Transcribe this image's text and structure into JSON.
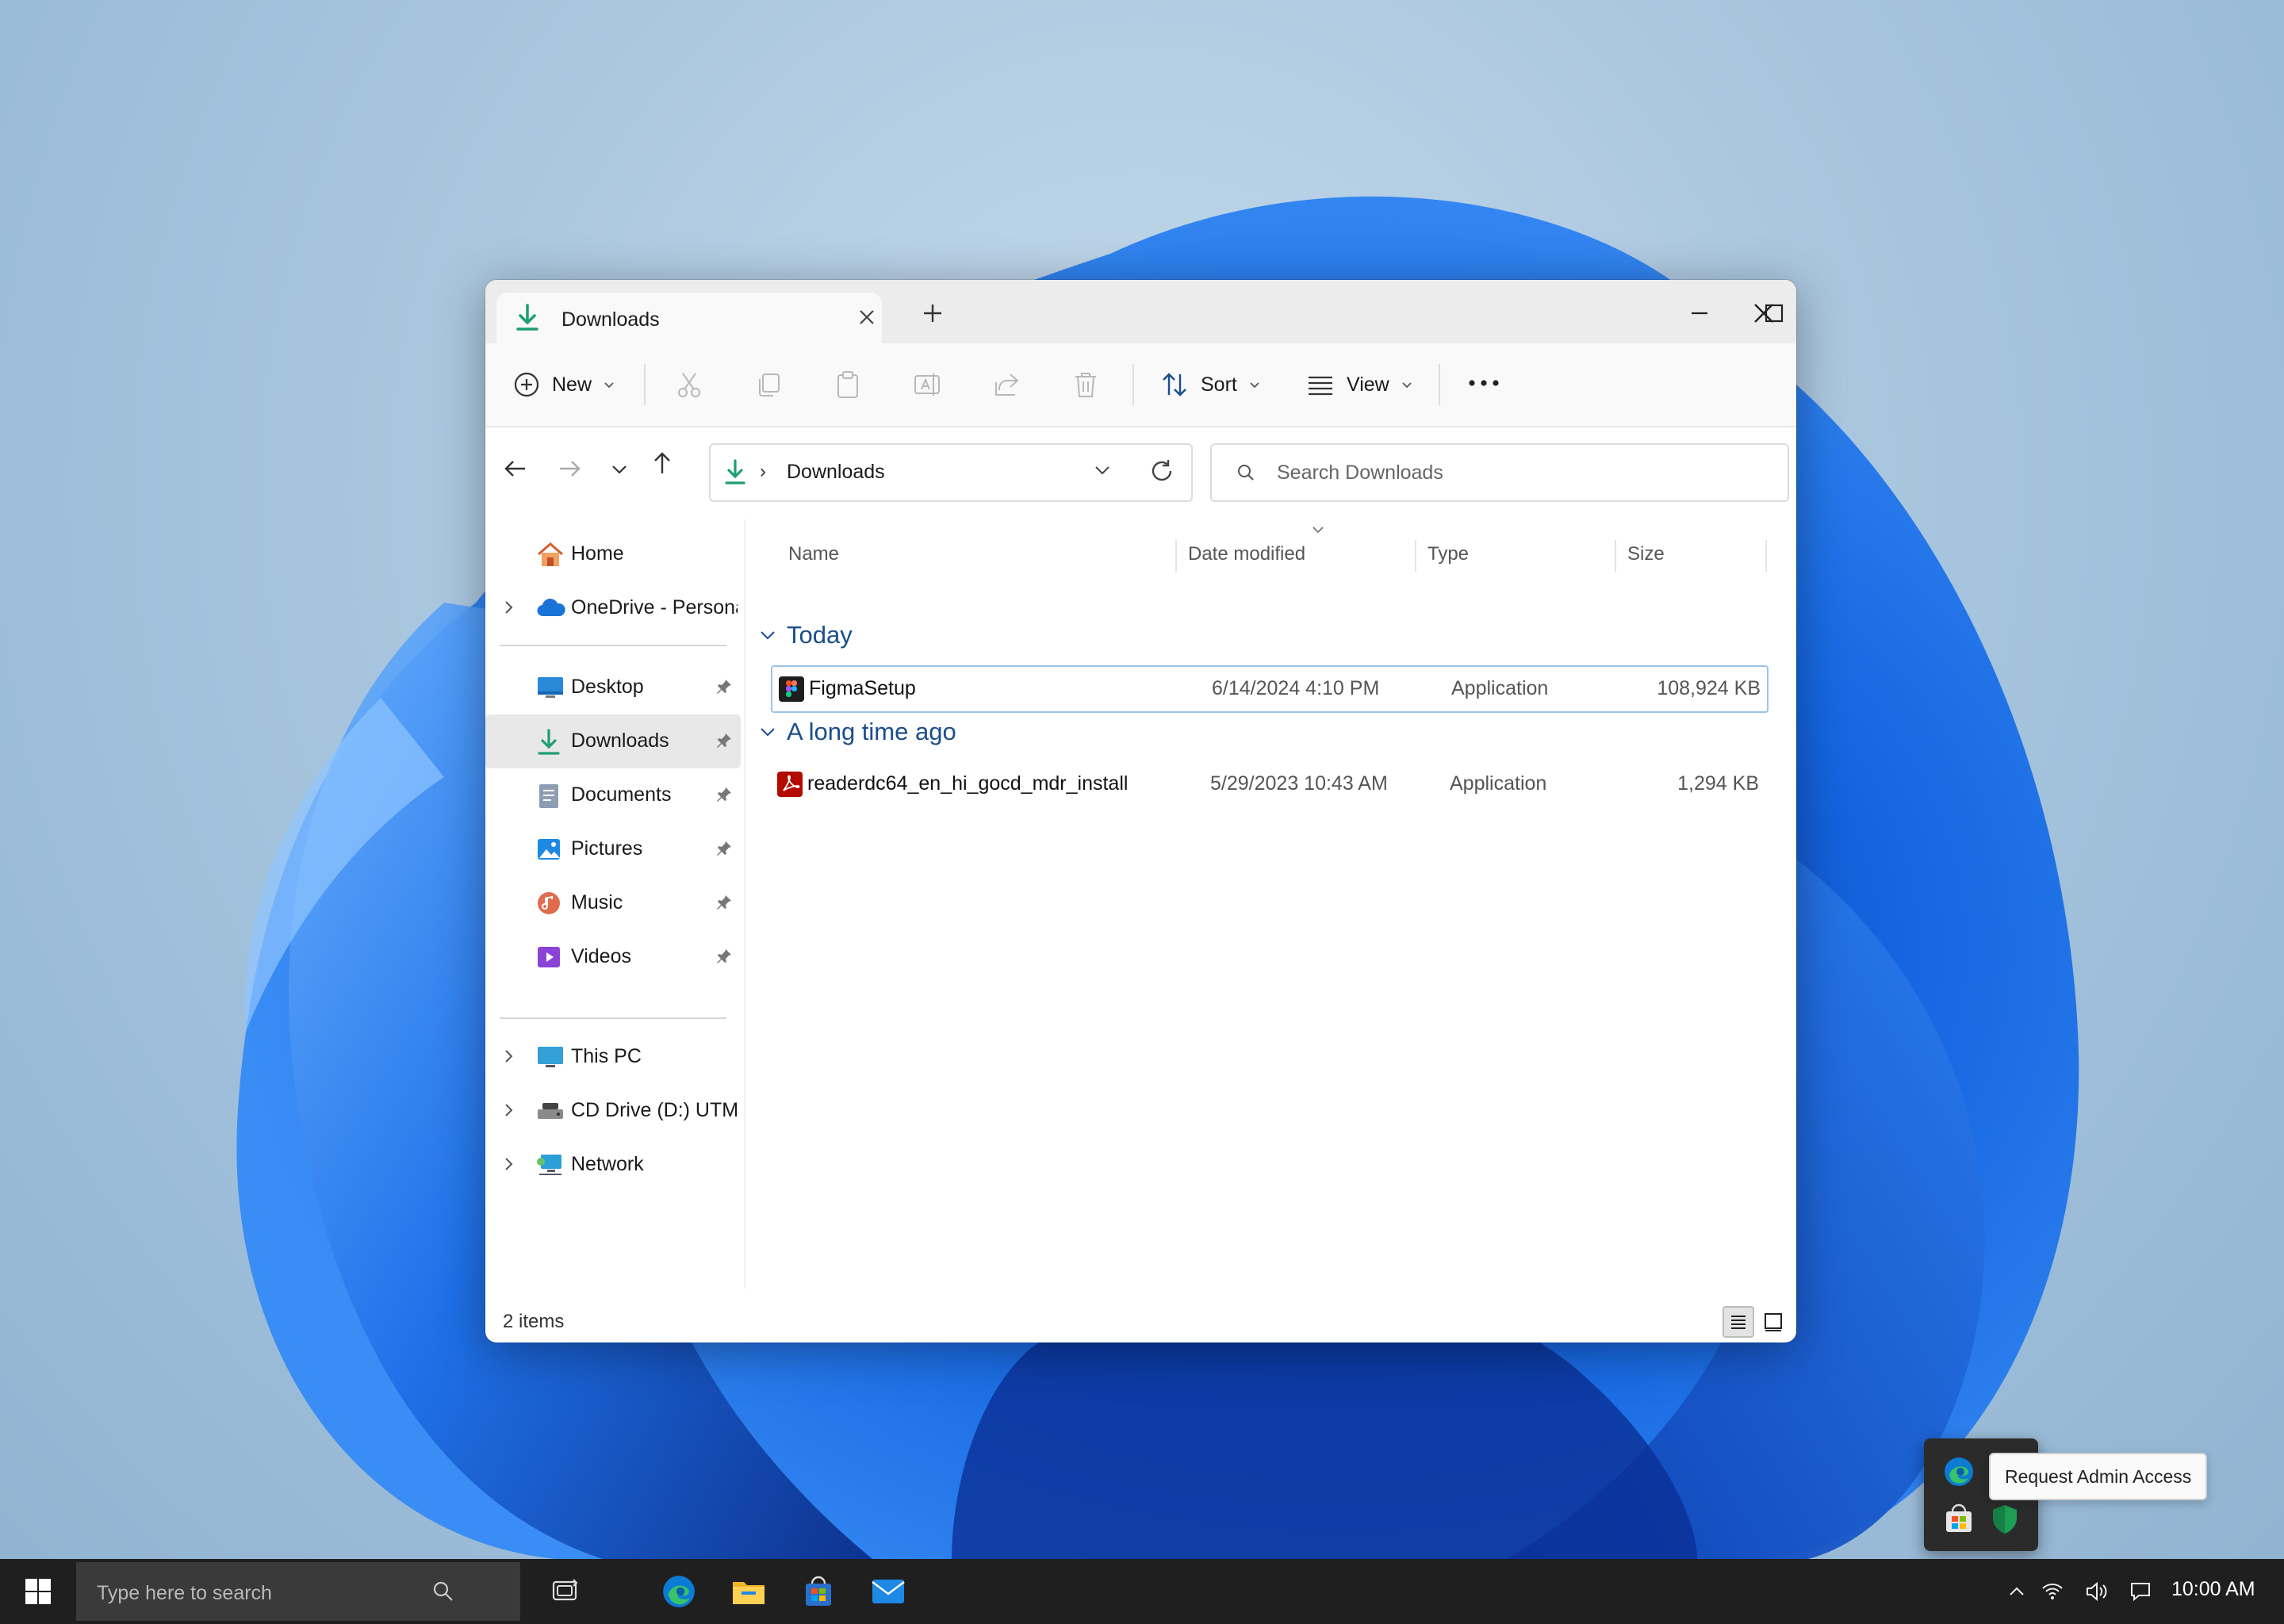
{
  "window": {
    "tab_title": "Downloads",
    "new_tab_symbol": "+"
  },
  "commandbar": {
    "new_label": "New",
    "sort_label": "Sort",
    "view_label": "View",
    "icons": [
      "cut-icon",
      "copy-icon",
      "paste-icon",
      "rename-icon",
      "share-icon",
      "delete-icon"
    ]
  },
  "address": {
    "location": "Downloads",
    "search_placeholder": "Search Downloads"
  },
  "sidebar": {
    "items": [
      {
        "label": "Home",
        "icon": "home-icon"
      },
      {
        "label": "OneDrive - Persona",
        "icon": "onedrive-icon"
      },
      {
        "label": "Desktop",
        "icon": "desktop-icon"
      },
      {
        "label": "Downloads",
        "icon": "downloads-icon"
      },
      {
        "label": "Documents",
        "icon": "documents-icon"
      },
      {
        "label": "Pictures",
        "icon": "pictures-icon"
      },
      {
        "label": "Music",
        "icon": "music-icon"
      },
      {
        "label": "Videos",
        "icon": "videos-icon"
      },
      {
        "label": "This PC",
        "icon": "this-pc-icon"
      },
      {
        "label": "CD Drive (D:) UTM",
        "icon": "cd-drive-icon"
      },
      {
        "label": "Network",
        "icon": "network-icon"
      }
    ]
  },
  "columns": {
    "name": "Name",
    "date": "Date modified",
    "type": "Type",
    "size": "Size"
  },
  "groups": [
    {
      "label": "Today",
      "files": [
        {
          "name": "FigmaSetup",
          "date": "6/14/2024 4:10 PM",
          "type": "Application",
          "size": "108,924 KB",
          "icon": "figma-icon"
        }
      ]
    },
    {
      "label": "A long time ago",
      "files": [
        {
          "name": "readerdc64_en_hi_gocd_mdr_install",
          "date": "5/29/2023 10:43 AM",
          "type": "Application",
          "size": "1,294 KB",
          "icon": "acrobat-icon"
        }
      ]
    }
  ],
  "status": {
    "item_count": "2 items"
  },
  "tray_popup": {
    "tooltip": "Request Admin Access"
  },
  "taskbar": {
    "search_placeholder": "Type here to search",
    "time": "10:00 AM"
  },
  "colors": {
    "accent_blue": "#1a4d8c",
    "download_green": "#1e9e73",
    "selection_border": "#99c4e8",
    "taskbar": "#1f1f1f"
  }
}
